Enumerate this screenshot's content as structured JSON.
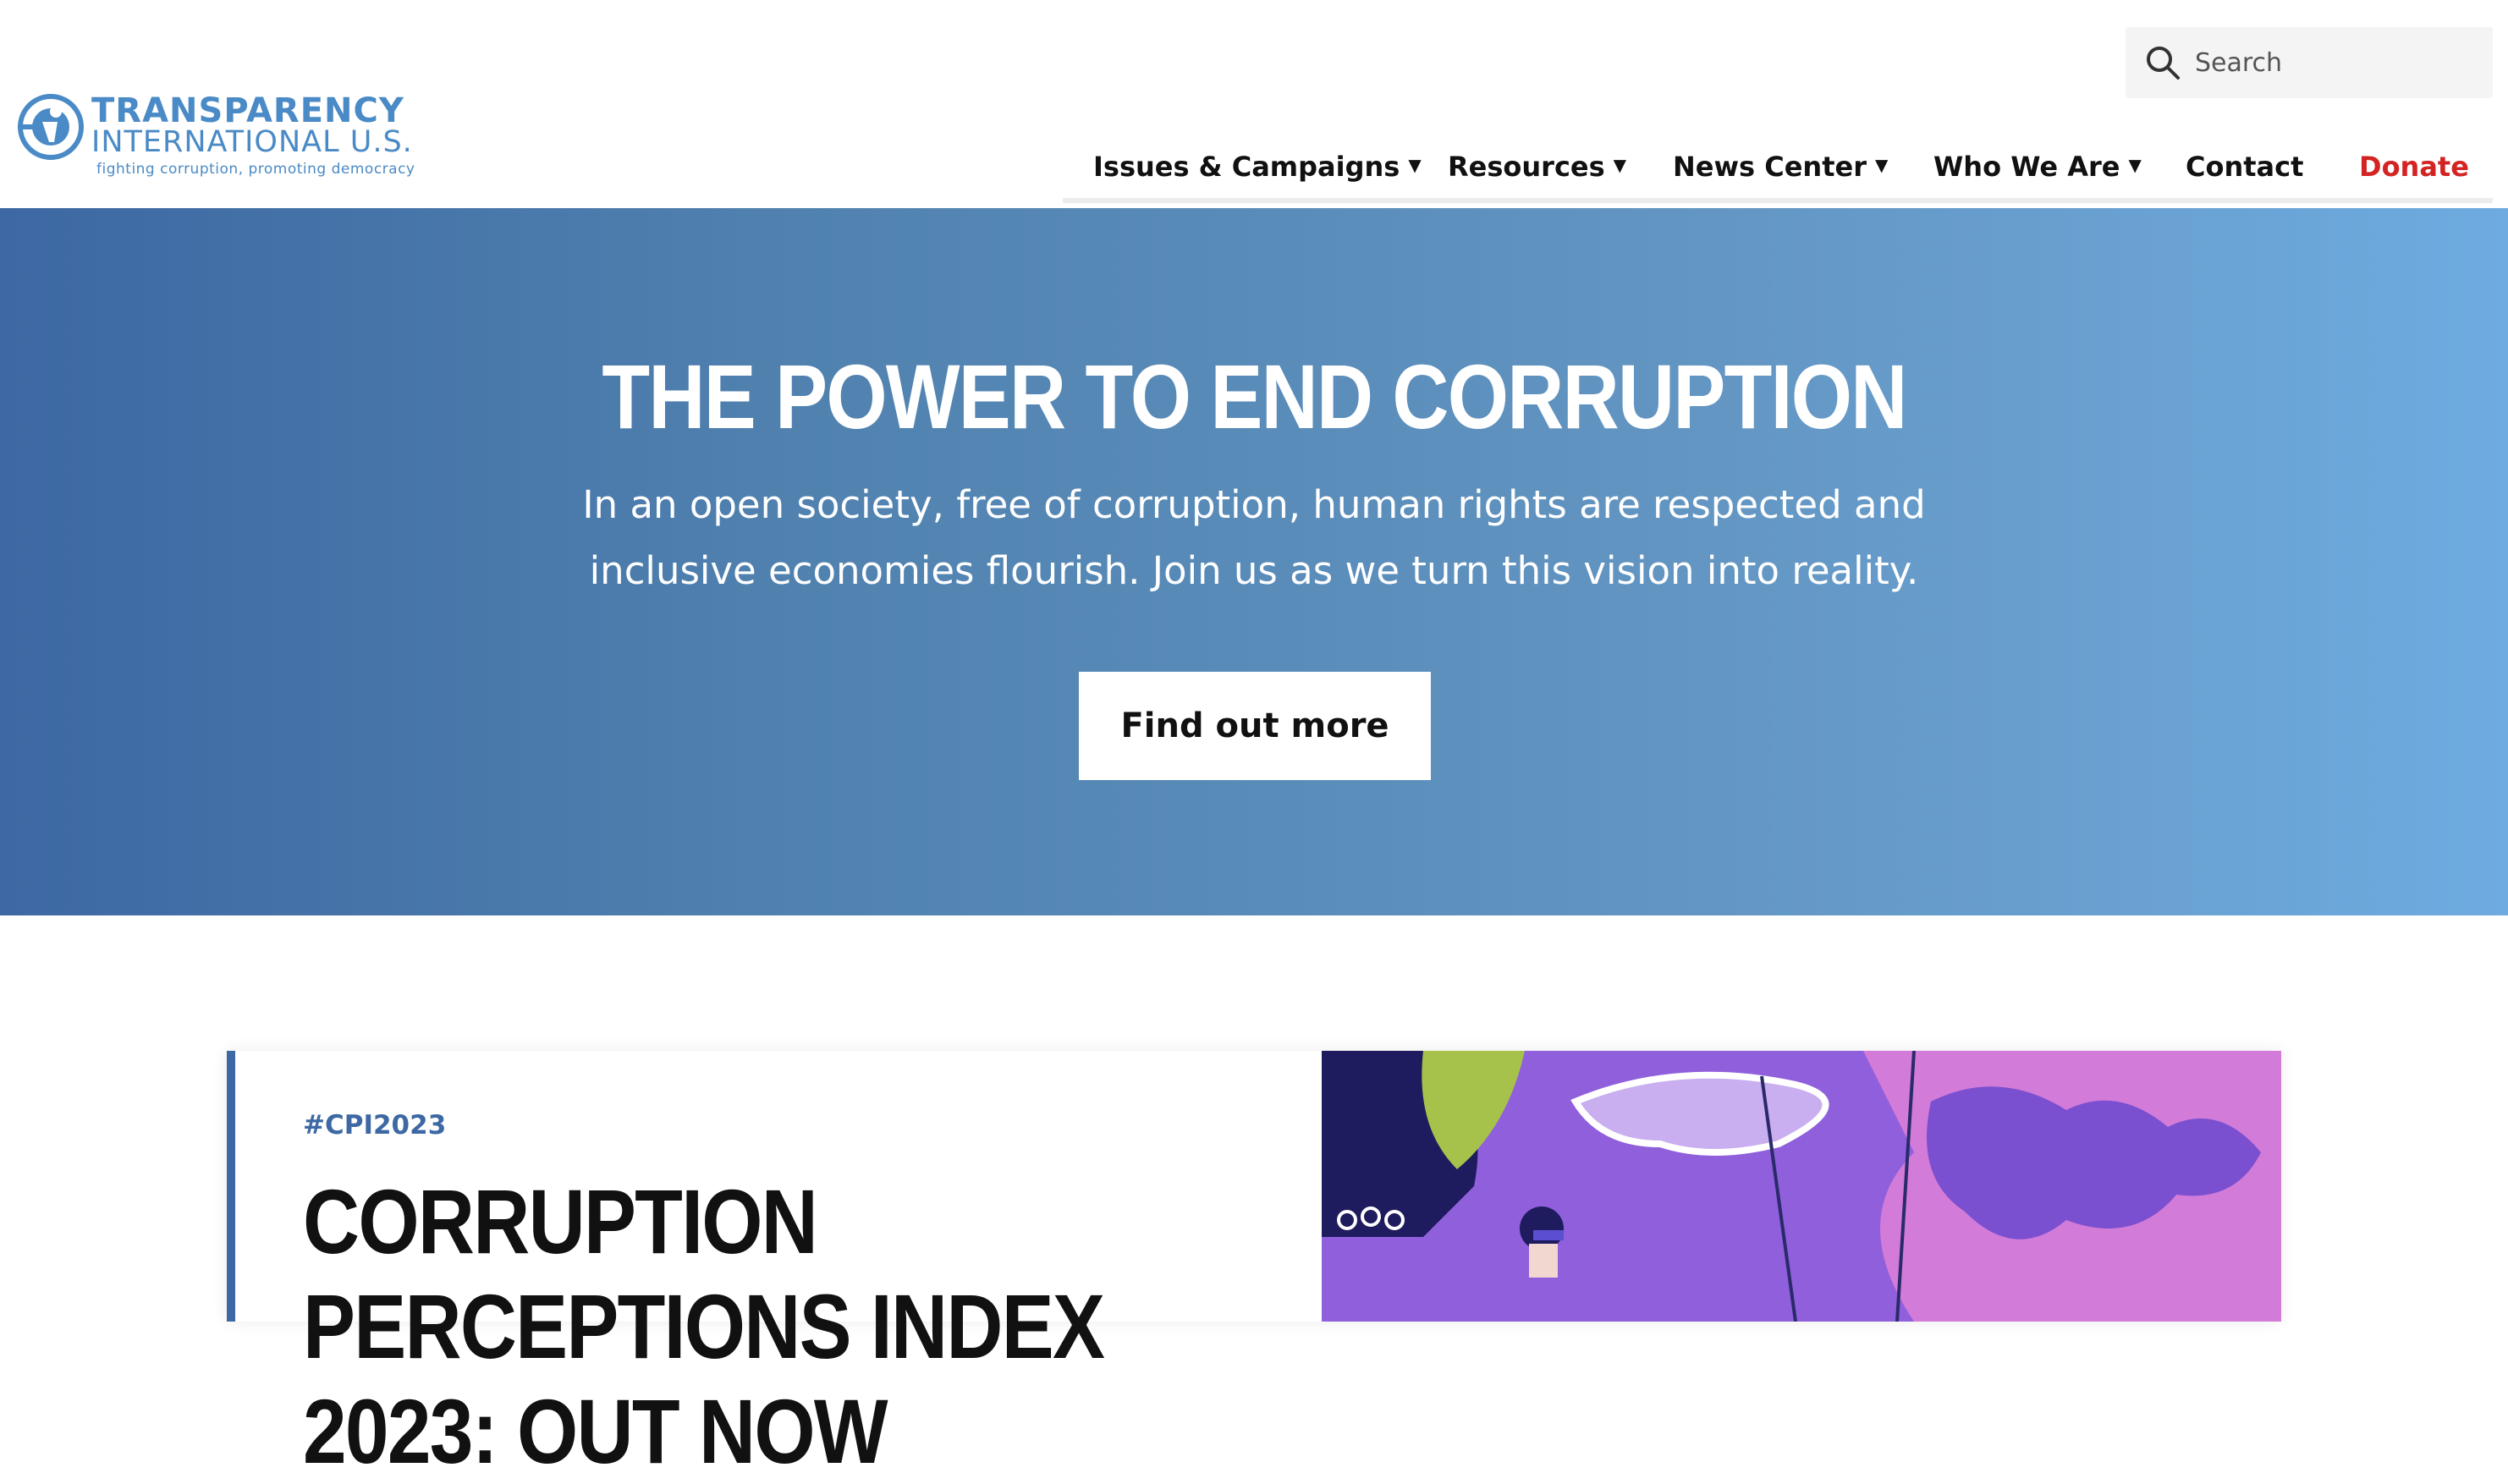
{
  "brand": {
    "line1": "TRANSPARENCY",
    "line2": "INTERNATIONAL U.S.",
    "tagline": "fighting corruption, promoting democracy",
    "color": "#4a8ac6"
  },
  "search": {
    "placeholder": "Search",
    "icon": "search-icon"
  },
  "nav": {
    "items": [
      {
        "label": "Issues & Campaigns",
        "has_dropdown": true
      },
      {
        "label": "Resources",
        "has_dropdown": true
      },
      {
        "label": "News Center",
        "has_dropdown": true
      },
      {
        "label": "Who We Are",
        "has_dropdown": true
      },
      {
        "label": "Contact",
        "has_dropdown": false
      },
      {
        "label": "Donate",
        "has_dropdown": false
      }
    ],
    "caret": "▼",
    "donate_color": "#d42323"
  },
  "hero": {
    "title": "THE POWER TO END CORRUPTION",
    "text": "In an open society, free of corruption, human rights are respected and inclusive economies flourish. Join us as we turn this vision into reality.",
    "button_label": "Find out more",
    "gradient_start": "#3d68a3",
    "gradient_end": "#6eabe0"
  },
  "feature": {
    "tag": "#CPI2023",
    "title": "CORRUPTION PERCEPTIONS INDEX 2023: OUT NOW",
    "accent": "#3d68a3"
  }
}
